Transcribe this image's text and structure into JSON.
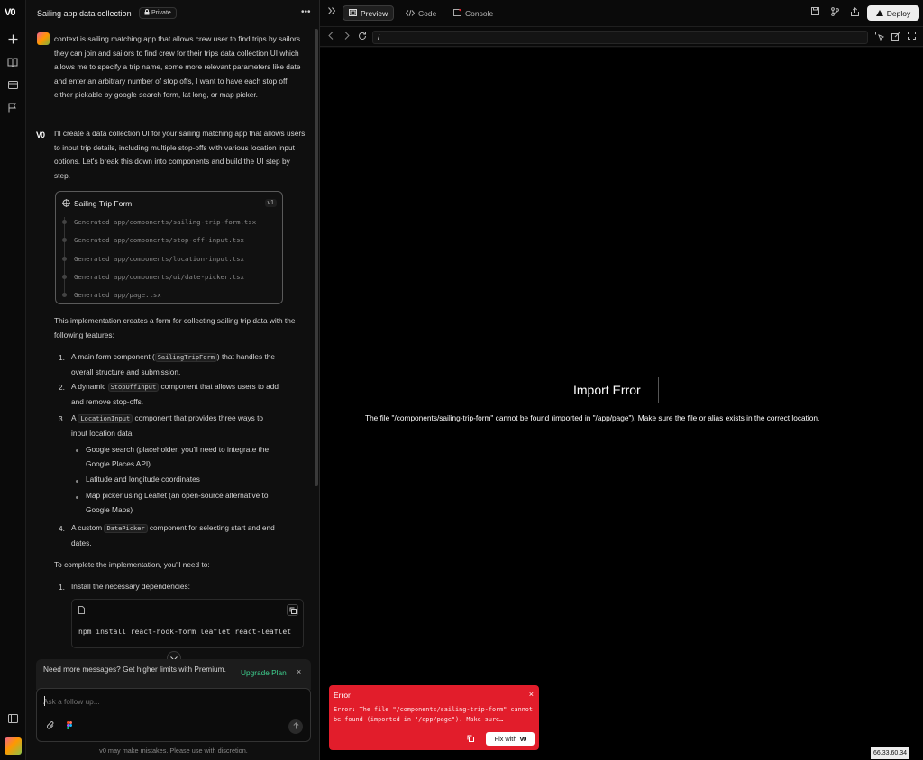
{
  "app": {
    "logo": "V0"
  },
  "chat": {
    "title": "Sailing app data collection",
    "privacy": "Private",
    "user_message": "context is sailing matching app that allows crew user to find trips by sailors they can join and sailors to find crew for their trips data collection UI which allows me to specify a trip name, some more relevant parameters like date and enter an arbitrary number of stop offs, I want to have each stop off either pickable by google search form, lat long, or map picker.",
    "assistant_intro": "I'll create a data collection UI for your sailing matching app that allows users to input trip details, including multiple stop-offs with various location input options. Let's break this down into components and build the UI step by step.",
    "card": {
      "title": "Sailing Trip Form",
      "version": "v1",
      "files": [
        "Generated app/components/sailing-trip-form.tsx",
        "Generated app/components/stop-off-input.tsx",
        "Generated app/components/location-input.tsx",
        "Generated app/components/ui/date-picker.tsx",
        "Generated app/page.tsx"
      ]
    },
    "impl_intro": "This implementation creates a form for collecting sailing trip data with the following features:",
    "features": {
      "f1_pre": "A main form component (",
      "f1_code": "SailingTripForm",
      "f1_post": ") that handles the",
      "f1_line2": "overall structure and submission.",
      "f2_pre": "A dynamic",
      "f2_code": "StopOffInput",
      "f2_post": "component that allows users to add",
      "f2_line2": "and remove stop-offs.",
      "f3_pre": "A",
      "f3_code": "LocationInput",
      "f3_post": "component that provides three ways to",
      "f3_line2": "input location data:",
      "sub1_line1": "Google search (placeholder, you'll need to integrate the",
      "sub1_line2": "Google Places API)",
      "sub2": "Latitude and longitude coordinates",
      "sub3_line1": "Map picker using Leaflet (an open-source alternative to",
      "sub3_line2": "Google Maps)",
      "f4_pre": "A custom",
      "f4_code": "DatePicker",
      "f4_post": "component for selecting start and end",
      "f4_line2": "dates."
    },
    "complete_intro": "To complete the implementation, you'll need to:",
    "step1": "Install the necessary dependencies:",
    "command": "npm install react-hook-form leaflet react-leaflet",
    "upgrade": {
      "text": "Need more messages? Get higher limits with Premium.",
      "button": "Upgrade Plan"
    },
    "composer": {
      "placeholder": "Ask a follow up..."
    },
    "disclaimer": "v0 may make mistakes. Please use with discretion."
  },
  "toolbar": {
    "tabs": [
      {
        "label": "Preview"
      },
      {
        "label": "Code"
      },
      {
        "label": "Console"
      }
    ],
    "deploy": "Deploy"
  },
  "urlbar": {
    "path": "/"
  },
  "preview": {
    "error_title": "Import Error",
    "error_message": "The file \"/components/sailing-trip-form\" cannot be found (imported in \"/app/page\"). Make sure the file or alias exists in the correct location."
  },
  "toast": {
    "title": "Error",
    "message": "Error: The file \"/components/sailing-trip-form\" cannot be found (imported in \"/app/page\"). Make sure…",
    "fix_label": "Fix with",
    "fix_logo": "V0"
  },
  "status": {
    "ip": "66.33.60.34"
  },
  "colors": {
    "accent": "#3ecf8e",
    "error": "#e21d2b",
    "background": "#0a0a0a"
  }
}
